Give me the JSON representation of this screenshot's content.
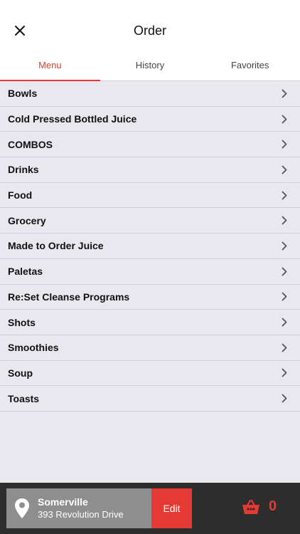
{
  "header": {
    "title": "Order",
    "close_icon": "close-icon"
  },
  "tabs": [
    {
      "label": "Menu",
      "active": true
    },
    {
      "label": "History",
      "active": false
    },
    {
      "label": "Favorites",
      "active": false
    }
  ],
  "menu": {
    "items": [
      {
        "label": "Bowls"
      },
      {
        "label": "Cold Pressed Bottled Juice"
      },
      {
        "label": "COMBOS"
      },
      {
        "label": "Drinks"
      },
      {
        "label": "Food"
      },
      {
        "label": "Grocery"
      },
      {
        "label": "Made to Order Juice"
      },
      {
        "label": "Paletas"
      },
      {
        "label": "Re:Set Cleanse Programs"
      },
      {
        "label": "Shots"
      },
      {
        "label": "Smoothies"
      },
      {
        "label": "Soup"
      },
      {
        "label": "Toasts"
      }
    ]
  },
  "bottom_bar": {
    "location_name": "Somerville",
    "location_address": "393 Revolution Drive",
    "edit_label": "Edit",
    "cart_count": "0"
  },
  "colors": {
    "accent": "#e53a34",
    "background": "#e9e8ee",
    "bar": "#2d2d2d"
  }
}
